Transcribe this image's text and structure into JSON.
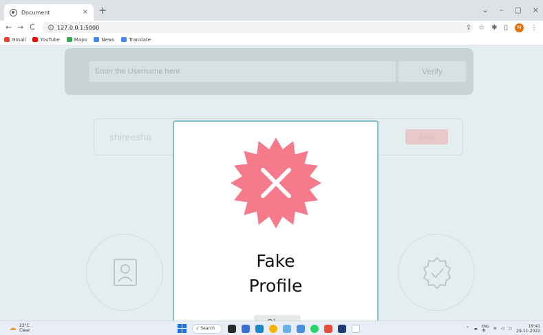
{
  "browser": {
    "tab_title": "Document",
    "tab_close": "×",
    "new_tab": "+",
    "window_controls": {
      "chevron": "⌄",
      "minimize": "–",
      "maximize": "▢",
      "close": "×"
    },
    "nav": {
      "back": "←",
      "forward": "→",
      "reload": "C"
    },
    "url": "127.0.0.1:5000",
    "profile_initial": "M",
    "bookmarks": [
      {
        "label": "Gmail",
        "color": "#1a73e8"
      },
      {
        "label": "YouTube",
        "color": "#ff0000"
      },
      {
        "label": "Maps",
        "color": "#34a853"
      },
      {
        "label": "News",
        "color": "#4285f4"
      },
      {
        "label": "Translate",
        "color": "#4285f4"
      }
    ]
  },
  "page": {
    "username_placeholder": "Enter the Username here",
    "verify_label": "Verify",
    "name_value": "shireesha",
    "save_label": "Save"
  },
  "modal": {
    "title_line1": "Fake",
    "title_line2": "Profile",
    "okay_label": "Okay",
    "badge_color": "#f57b8c"
  },
  "taskbar": {
    "temperature": "23°C",
    "weather": "Clear",
    "search_label": "Search",
    "lang": "ENG",
    "lang_region": "IN",
    "time": "19:41",
    "date": "29-11-2022"
  }
}
